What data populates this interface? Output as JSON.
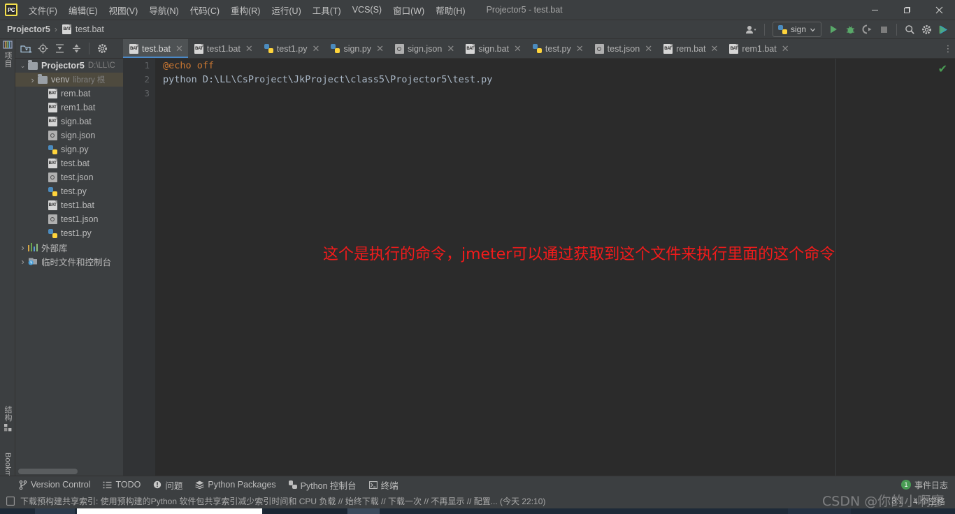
{
  "window": {
    "title": "Projector5 - test.bat",
    "logo_text": "PC",
    "minimize": "—",
    "maximize": "❐",
    "close": "✕"
  },
  "menu": [
    {
      "label": "文件(F)"
    },
    {
      "label": "编辑(E)"
    },
    {
      "label": "视图(V)"
    },
    {
      "label": "导航(N)"
    },
    {
      "label": "代码(C)"
    },
    {
      "label": "重构(R)"
    },
    {
      "label": "运行(U)"
    },
    {
      "label": "工具(T)"
    },
    {
      "label": "VCS(S)"
    },
    {
      "label": "窗口(W)"
    },
    {
      "label": "帮助(H)"
    }
  ],
  "breadcrumb": {
    "project": "Projector5",
    "separator": "›",
    "file": "test.bat"
  },
  "toolbar": {
    "account_icon": "user-icon",
    "run_config": "sign",
    "run": "run-icon",
    "debug": "debug-icon",
    "coverage": "coverage-icon",
    "stop": "stop-icon",
    "search": "search-icon",
    "settings": "gear-icon",
    "updates": "updates-icon"
  },
  "left_strip": {
    "project_tab": "项目",
    "structure_tab": "结构",
    "bookmarks_tab": "Bookmarks"
  },
  "project_panel": {
    "toolbar_icons": [
      "select-opened-file-icon",
      "locate-icon",
      "expand-all-icon",
      "collapse-all-icon",
      "settings-icon"
    ],
    "tree": [
      {
        "label": "Projector5",
        "sub": "D:\\LL\\C",
        "indent": 0,
        "arrow": "▾",
        "icon": "folder-icon",
        "bold": true,
        "selected": false
      },
      {
        "label": "venv",
        "sub": "library 根",
        "indent": 1,
        "arrow": "›",
        "icon": "folder-icon",
        "bold": false,
        "selected": true
      },
      {
        "label": "rem.bat",
        "sub": "",
        "indent": 2,
        "arrow": "",
        "icon": "bat-icon",
        "bold": false,
        "selected": false
      },
      {
        "label": "rem1.bat",
        "sub": "",
        "indent": 2,
        "arrow": "",
        "icon": "bat-icon",
        "bold": false,
        "selected": false
      },
      {
        "label": "sign.bat",
        "sub": "",
        "indent": 2,
        "arrow": "",
        "icon": "bat-icon",
        "bold": false,
        "selected": false
      },
      {
        "label": "sign.json",
        "sub": "",
        "indent": 2,
        "arrow": "",
        "icon": "json-icon",
        "bold": false,
        "selected": false
      },
      {
        "label": "sign.py",
        "sub": "",
        "indent": 2,
        "arrow": "",
        "icon": "py-icon",
        "bold": false,
        "selected": false
      },
      {
        "label": "test.bat",
        "sub": "",
        "indent": 2,
        "arrow": "",
        "icon": "bat-icon",
        "bold": false,
        "selected": false
      },
      {
        "label": "test.json",
        "sub": "",
        "indent": 2,
        "arrow": "",
        "icon": "json-icon",
        "bold": false,
        "selected": false
      },
      {
        "label": "test.py",
        "sub": "",
        "indent": 2,
        "arrow": "",
        "icon": "py-icon",
        "bold": false,
        "selected": false
      },
      {
        "label": "test1.bat",
        "sub": "",
        "indent": 2,
        "arrow": "",
        "icon": "bat-icon",
        "bold": false,
        "selected": false
      },
      {
        "label": "test1.json",
        "sub": "",
        "indent": 2,
        "arrow": "",
        "icon": "json-icon",
        "bold": false,
        "selected": false
      },
      {
        "label": "test1.py",
        "sub": "",
        "indent": 2,
        "arrow": "",
        "icon": "py-icon",
        "bold": false,
        "selected": false
      },
      {
        "label": "外部库",
        "sub": "",
        "indent": 0,
        "arrow": "›",
        "icon": "library-icon",
        "bold": false,
        "selected": false
      },
      {
        "label": "临时文件和控制台",
        "sub": "",
        "indent": 0,
        "arrow": "›",
        "icon": "scratch-icon",
        "bold": false,
        "selected": false
      }
    ]
  },
  "editor": {
    "tabs": [
      {
        "label": "test.bat",
        "icon": "bat-icon",
        "active": true
      },
      {
        "label": "test1.bat",
        "icon": "bat-icon",
        "active": false
      },
      {
        "label": "test1.py",
        "icon": "py-icon",
        "active": false
      },
      {
        "label": "sign.py",
        "icon": "py-icon",
        "active": false
      },
      {
        "label": "sign.json",
        "icon": "json-icon",
        "active": false
      },
      {
        "label": "sign.bat",
        "icon": "bat-icon",
        "active": false
      },
      {
        "label": "test.py",
        "icon": "py-icon",
        "active": false
      },
      {
        "label": "test.json",
        "icon": "json-icon",
        "active": false
      },
      {
        "label": "rem.bat",
        "icon": "bat-icon",
        "active": false
      },
      {
        "label": "rem1.bat",
        "icon": "bat-icon",
        "active": false
      }
    ],
    "tab_close_glyph": "✕",
    "tab_overflow_glyph": "⋮",
    "line_numbers": [
      "1",
      "2",
      "3"
    ],
    "code": {
      "line1_at": "@",
      "line1_rest": "echo off",
      "line2": "python D:\\LL\\CsProject\\JkProject\\class5\\Projector5\\test.py",
      "line3": ""
    },
    "inspection_ok": "✔",
    "annotation": "这个是执行的命令，jmeter可以通过获取到这个文件来执行里面的这个命令",
    "annotation_color": "#f21b1b"
  },
  "bottom_bar": {
    "items": [
      {
        "label": "Version Control",
        "icon": "branch-icon"
      },
      {
        "label": "TODO",
        "icon": "todo-icon"
      },
      {
        "label": "问题",
        "icon": "problems-icon"
      },
      {
        "label": "Python Packages",
        "icon": "packages-icon"
      },
      {
        "label": "Python 控制台",
        "icon": "python-console-icon"
      },
      {
        "label": "终端",
        "icon": "terminal-icon"
      }
    ],
    "event_log": {
      "label": "事件日志",
      "count": "1"
    }
  },
  "status_bar": {
    "message": "下载预构建共享索引: 使用预构建的Python 软件包共享索引减少索引时间和 CPU 负载 // 始终下载 // 下载一次 // 不再显示 // 配置... (今天 22:10)",
    "caret": "3:1",
    "indent": "4 个空格",
    "message_icon": "notification-icon"
  },
  "watermark": {
    "text": "CSDN @你的小啊廖"
  }
}
